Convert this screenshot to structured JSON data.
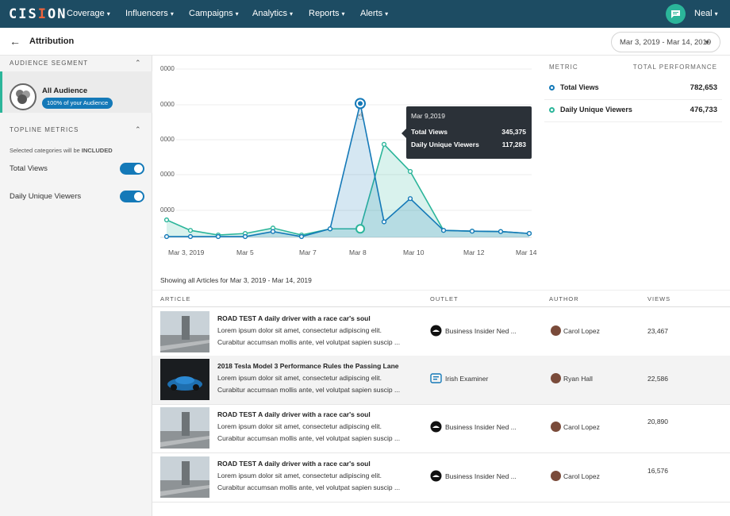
{
  "app": {
    "logo_main": "CIS",
    "logo_accent": "I",
    "logo_end": "ON",
    "nav": [
      {
        "label": "Coverage"
      },
      {
        "label": "Influencers"
      },
      {
        "label": "Campaigns"
      },
      {
        "label": "Analytics"
      },
      {
        "label": "Reports"
      },
      {
        "label": "Alerts"
      }
    ],
    "user": "Neal"
  },
  "header": {
    "back_icon": "←",
    "title": "Attribution",
    "date_range": "Mar 3, 2019 - Mar 14, 2019"
  },
  "sidebar": {
    "audience_heading": "AUDIENCE SEGMENT",
    "audience_name": "All Audience",
    "audience_badge": "100% of your Audience",
    "topline_heading": "TOPLINE METRICS",
    "note_prefix": "Selected categories will be ",
    "note_bold": "INCLUDED",
    "toggles": [
      {
        "label": "Total Views",
        "on": true
      },
      {
        "label": "Daily Unique Viewers",
        "on": true
      }
    ]
  },
  "metrics": {
    "col_metric": "METRIC",
    "col_total": "TOTAL PERFORMANCE",
    "rows": [
      {
        "label": "Total Views",
        "value": "782,653",
        "color": "#1479b8"
      },
      {
        "label": "Daily Unique Viewers",
        "value": "476,733",
        "color": "#2bb59a"
      }
    ]
  },
  "tooltip": {
    "date": "Mar 9,2019",
    "rows": [
      {
        "label": "Total Views",
        "value": "345,375"
      },
      {
        "label": "Daily Unique Viewers",
        "value": "117,283"
      }
    ]
  },
  "chart_data": {
    "type": "area",
    "y_tick_labels": [
      "0000",
      "0000",
      "0000",
      "0000",
      "0000"
    ],
    "x_tick_labels": [
      "Mar 3, 2019",
      "Mar 5",
      "Mar 7",
      "Mar 8",
      "Mar 10",
      "Mar 12",
      "Mar 14"
    ],
    "x": [
      "Mar 3",
      "Mar 4",
      "Mar 5",
      "Mar 6",
      "Mar 7",
      "Mar 8",
      "Mar 8.5",
      "Mar 9",
      "Mar 9.5",
      "Mar 10",
      "Mar 11",
      "Mar 12",
      "Mar 13",
      "Mar 14"
    ],
    "ylim": [
      0,
      400000
    ],
    "series": [
      {
        "name": "Total Views",
        "color": "#1479b8",
        "values": [
          2000,
          2000,
          2000,
          2000,
          15000,
          2000,
          22000,
          345375,
          40000,
          100000,
          18000,
          16000,
          15000,
          10000
        ]
      },
      {
        "name": "Daily Unique Viewers",
        "color": "#2bb59a",
        "values": [
          45000,
          18000,
          6000,
          10000,
          24000,
          6000,
          22000,
          22000,
          240000,
          170000,
          18000,
          16000,
          15000,
          10000
        ]
      }
    ],
    "grid": true,
    "legend": "right"
  },
  "table": {
    "showing": "Showing all Articles for Mar 3, 2019 - Mar 14, 2019",
    "headers": [
      "ARTICLE",
      "OUTLET",
      "AUTHOR",
      "VIEWS"
    ],
    "rows": [
      {
        "title": "ROAD TEST A daily driver with a race car's soul",
        "line1": "Lorem ipsum dolor sit amet, consectetur adipiscing elit.",
        "line2": "Curabitur accumsan mollis ante, vel volutpat sapien suscip ...",
        "outlet": "Business Insider Ned ...",
        "author": "Carol Lopez",
        "views": "23,467",
        "thumb": "building"
      },
      {
        "title": "2018 Tesla Model 3 Performance Rules the Passing Lane",
        "line1": "Lorem ipsum dolor sit amet, consectetur adipiscing elit.",
        "line2": "Curabitur accumsan mollis ante, vel volutpat sapien suscip ...",
        "outlet": "Irish Examiner",
        "author": "Ryan Hall",
        "views": "22,586",
        "thumb": "car"
      },
      {
        "title": "ROAD TEST A daily driver with a race car's soul",
        "line1": "Lorem ipsum dolor sit amet, consectetur adipiscing elit.",
        "line2": "Curabitur accumsan mollis ante, vel volutpat sapien suscip ...",
        "outlet": "Business Insider Ned ...",
        "author": "Carol Lopez",
        "views": "20,890",
        "thumb": "building"
      },
      {
        "title": "ROAD TEST A daily driver with a race car's soul",
        "line1": "Lorem ipsum dolor sit amet, consectetur adipiscing elit.",
        "line2": "Curabitur accumsan mollis ante, vel volutpat sapien suscip ...",
        "outlet": "Business Insider Ned ...",
        "author": "Carol Lopez",
        "views": "16,576",
        "thumb": "building"
      }
    ]
  }
}
